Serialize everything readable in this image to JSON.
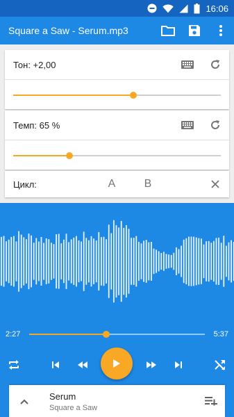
{
  "status_bar": {
    "time": "16:06"
  },
  "app_bar": {
    "title": "Square a Saw - Serum.mp3"
  },
  "pitch": {
    "label": "Тон: +2,00",
    "value_fraction": 0.58
  },
  "tempo": {
    "label": "Темп: 65 %",
    "value_fraction": 0.27
  },
  "loop": {
    "label": "Цикл:",
    "a_label": "A",
    "b_label": "B"
  },
  "playback": {
    "elapsed": "2:27",
    "total": "5:37",
    "progress_fraction": 0.44
  },
  "now_playing": {
    "title": "Serum",
    "artist": "Square a Saw"
  },
  "colors": {
    "primary": "#1e88e5",
    "status_bar": "#1565c0",
    "accent": "#f9a825"
  },
  "icons": [
    "minus-circle-icon",
    "wifi-icon",
    "signal-icon",
    "battery-icon",
    "folder-icon",
    "save-icon",
    "more-vert-icon",
    "keyboard-icon",
    "reset-icon",
    "close-icon",
    "repeat-icon",
    "skip-previous-icon",
    "rewind-icon",
    "play-icon",
    "fast-forward-icon",
    "skip-next-icon",
    "shuffle-icon",
    "expand-up-icon",
    "playlist-add-icon"
  ]
}
